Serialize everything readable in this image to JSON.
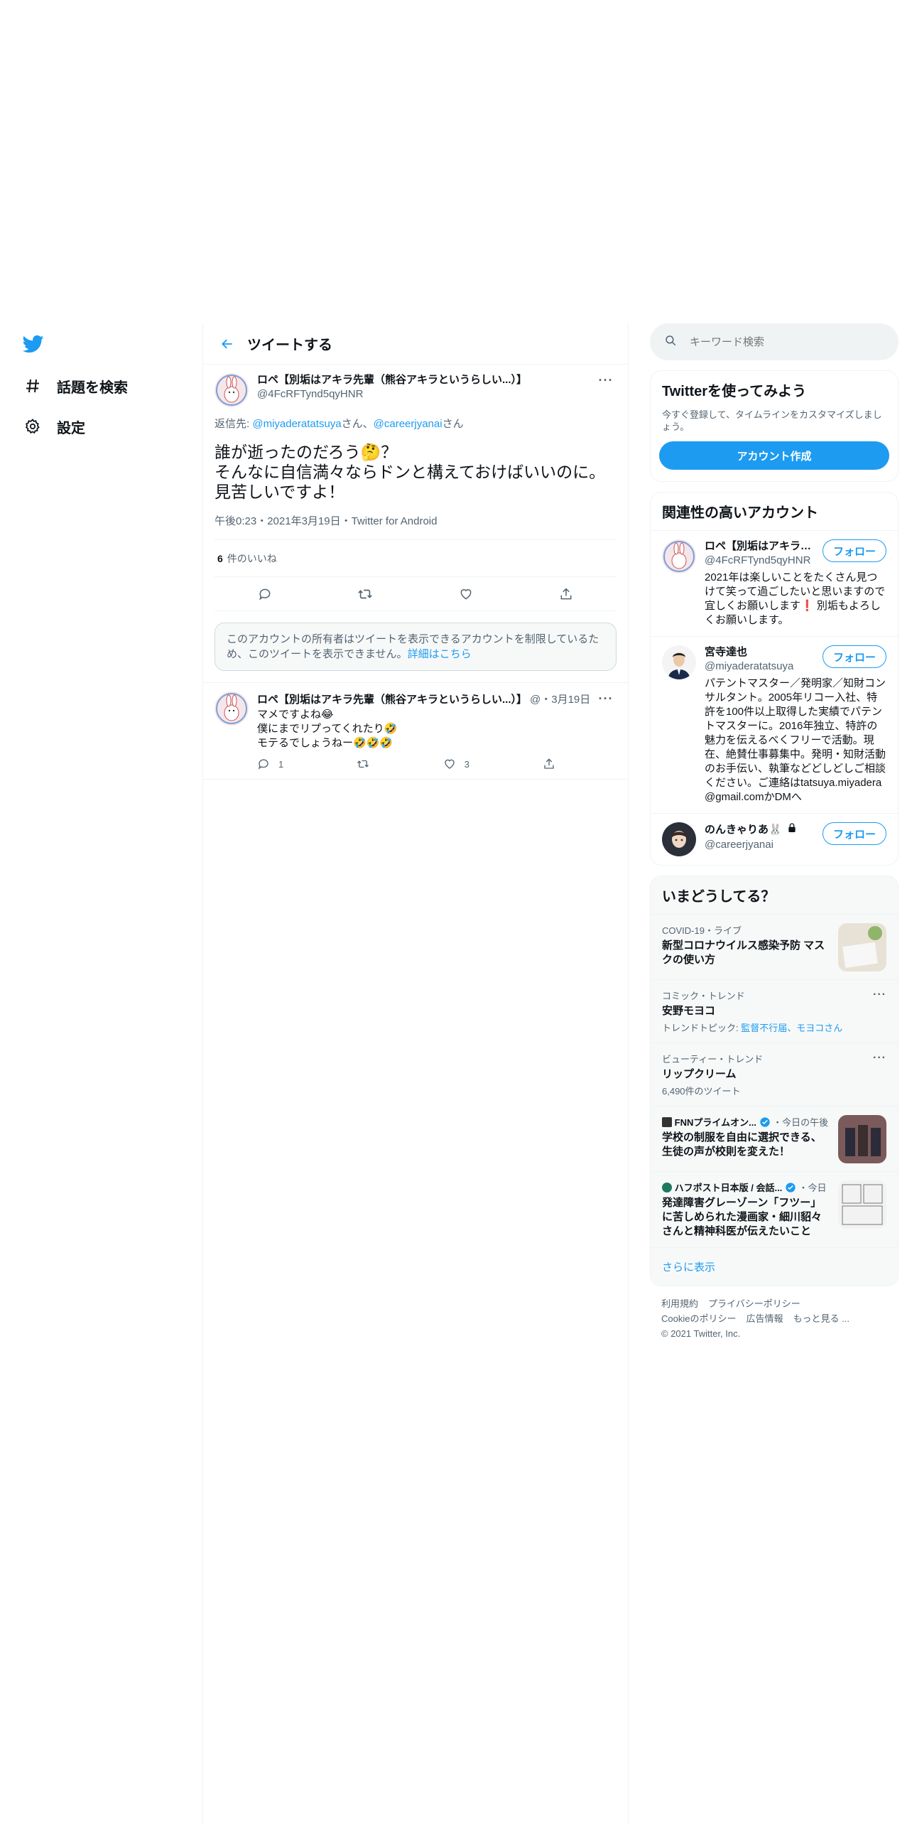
{
  "nav": {
    "items": [
      {
        "label": "話題を検索",
        "icon": "hashtag-icon"
      },
      {
        "label": "設定",
        "icon": "gear-icon"
      }
    ]
  },
  "header": {
    "title": "ツイートする"
  },
  "tweet": {
    "name": "ロペ【別垢はアキラ先輩（熊谷アキラというらしい...）】",
    "handle": "@4FcRFTynd5qyHNR",
    "reply_prefix": "返信先: ",
    "reply_user1": "@miyaderatatsuya",
    "reply_san1": "さん、",
    "reply_user2": "@careerjyanai",
    "reply_san2": "さん",
    "text": "誰が逝ったのだろう🤔？\nそんなに自信満々ならドンと構えておけばいいのに。\n見苦しいですよ！",
    "meta": "午後0:23・2021年3月19日・Twitter for Android",
    "likes_count": "6",
    "likes_label": "件のいいね"
  },
  "restricted": {
    "text": "このアカウントの所有者はツイートを表示できるアカウントを制限しているため、このツイートを表示できません。",
    "link": "詳細はこちら"
  },
  "reply": {
    "name": "ロペ【別垢はアキラ先輩（熊谷アキラというらしい...）】",
    "handle_date": "@・3月19日",
    "text": "マメですよね😂\n僕にまでリプってくれたり🤣\nモテるでしょうねー🤣🤣🤣",
    "reply_count": "1",
    "like_count": "3"
  },
  "search": {
    "placeholder": "キーワード検索"
  },
  "signup": {
    "title": "Twitterを使ってみよう",
    "subtitle": "今すぐ登録して、タイムラインをカスタマイズしましょう。",
    "button": "アカウント作成"
  },
  "relevant": {
    "title": "関連性の高いアカウント",
    "follow_label": "フォロー",
    "accounts": [
      {
        "name": "ロペ【別垢はアキラ先輩（熊谷アキラというらしい...）】",
        "handle": "@4FcRFTynd5qyHNR",
        "bio": "2021年は楽しいことをたくさん見つけて笑って過ごしたいと思いますので宜しくお願いします❗ 別垢もよろしくお願いします。"
      },
      {
        "name": "宮寺達也",
        "handle": "@miyaderatatsuya",
        "bio": "パテントマスター／発明家／知財コンサルタント。2005年リコー入社、特許を100件以上取得した実績でパテントマスターに。2016年独立、特許の魅力を伝えるべくフリーで活動。現在、絶賛仕事募集中。発明・知財活動のお手伝い、執筆などどしどしご相談ください。ご連絡はtatsuya.miyadera@gmail.comかDMへ"
      },
      {
        "name": "のんきゃりあ🐰",
        "handle": "@careerjyanai",
        "bio": ""
      }
    ]
  },
  "trends": {
    "title": "いまどうしてる？",
    "items": [
      {
        "context": "COVID-19・ライブ",
        "title": "新型コロナウイルス感染予防 マスクの使い方",
        "sub": "",
        "thumb": true
      },
      {
        "context": "コミック・トレンド",
        "title": "安野モヨコ",
        "sub_prefix": "トレンドトピック: ",
        "sub_links": "監督不行届、モヨコさん",
        "thumb": false
      },
      {
        "context": "ビューティー・トレンド",
        "title": "リップクリーム",
        "sub": "6,490件のツイート",
        "thumb": false
      },
      {
        "source": "FNNプライムオン...",
        "time": "・今日の午後",
        "title": "学校の制服を自由に選択できる、生徒の声が校則を変えた！",
        "thumb": true
      },
      {
        "source": "ハフポスト日本版 / 会話...",
        "time": "・今日",
        "title": "発達障害グレーゾーン「フツー」に苦しめられた漫画家・細川貂々さんと精神科医が伝えたいこと",
        "thumb": true
      }
    ],
    "show_more": "さらに表示"
  },
  "footer": {
    "links": [
      "利用規約",
      "プライバシーポリシー",
      "Cookieのポリシー",
      "広告情報",
      "もっと見る ..."
    ],
    "copyright": "© 2021 Twitter, Inc."
  },
  "colors": {
    "accent": "#1d9bf0",
    "text": "#0f1419",
    "muted": "#536471"
  }
}
